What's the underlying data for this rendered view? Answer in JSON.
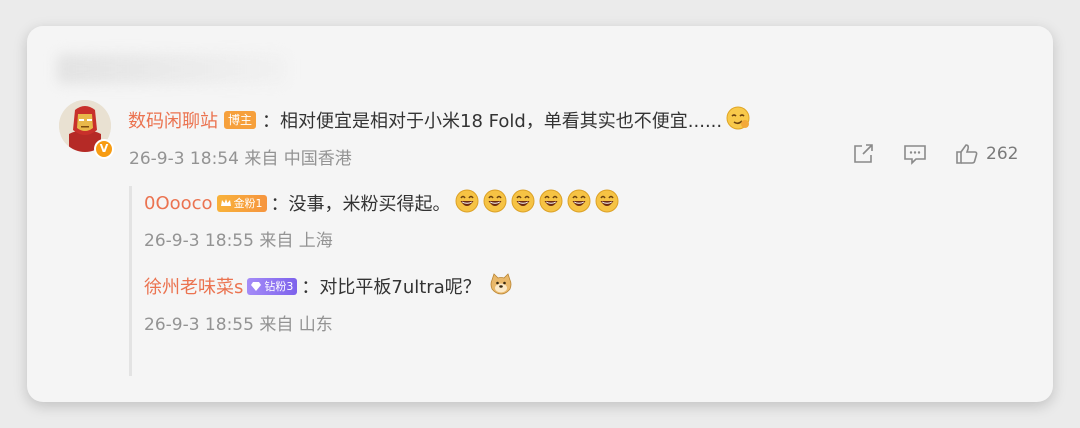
{
  "comment": {
    "username": "数码闲聊站",
    "badge": "博主",
    "text": "：相对便宜是相对于小米18 Fold，单看其实也不便宜......",
    "meta": "26-9-3 18:54 来自 中国香港",
    "like_count": "262",
    "verified_mark": "V"
  },
  "replies": [
    {
      "username": "0Oooco",
      "badge": "金粉1",
      "text": "：没事，米粉买得起。",
      "meta": "26-9-3 18:55 来自 上海",
      "emoji_count": 6
    },
    {
      "username": "徐州老味菜s",
      "badge": "钻粉3",
      "text": "：对比平板7ultra呢？",
      "meta": "26-9-3 18:55 来自 山东"
    }
  ],
  "icons": {
    "share": "share-icon",
    "comment": "comment-icon",
    "like": "thumbs-up-icon",
    "smirk_emoji": "smirk-emoji-icon",
    "laugh_emoji": "grin-emoji-icon",
    "doge_emoji": "doge-emoji-icon"
  },
  "colors": {
    "username": "#eb7350",
    "host_badge": "#f6a03c",
    "gold_badge": "#f6953f",
    "diamond_badge": "#7d62ec",
    "verified": "#f79c13"
  }
}
